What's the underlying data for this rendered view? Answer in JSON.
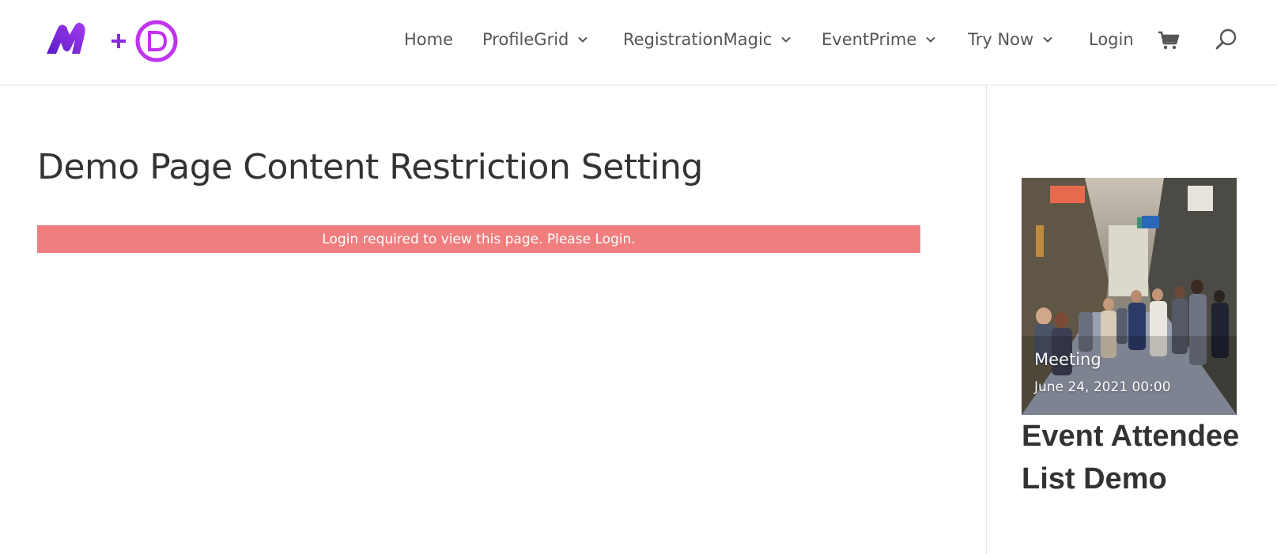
{
  "header": {
    "logo_text_m": "M",
    "logo_text_plus": "+",
    "logo_text_d": "D",
    "nav": [
      {
        "label": "Home",
        "has_dropdown": false
      },
      {
        "label": "ProfileGrid",
        "has_dropdown": true
      },
      {
        "label": "RegistrationMagic",
        "has_dropdown": true
      },
      {
        "label": "EventPrime",
        "has_dropdown": true
      },
      {
        "label": "Try Now",
        "has_dropdown": true
      },
      {
        "label": "Login",
        "has_dropdown": false
      }
    ],
    "icons": {
      "cart": "cart-icon",
      "search": "search-icon",
      "dropdown": "chevron-down-icon"
    }
  },
  "main": {
    "title": "Demo Page Content Restriction Setting",
    "notice": "Login required to view this page. Please Login."
  },
  "sidebar": {
    "event": {
      "name": "Meeting",
      "date": "June 24, 2021 00:00"
    },
    "widget_title": "Event Attendee List Demo"
  },
  "colors": {
    "brand_purple": "#8a2be2",
    "brand_magenta": "#c033f0",
    "notice_bg": "#f07e7e",
    "divider": "#e3e3e3"
  }
}
